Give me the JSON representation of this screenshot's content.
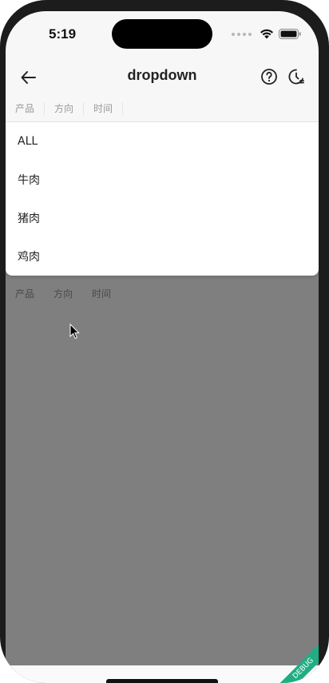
{
  "status_bar": {
    "time": "5:19"
  },
  "app_bar": {
    "title": "dropdown",
    "back_icon": "arrow-left-icon",
    "help_icon": "question-circle-icon",
    "history_icon": "history-icon"
  },
  "filters": {
    "tabs": [
      {
        "label": "产品"
      },
      {
        "label": "方向"
      },
      {
        "label": "时间"
      }
    ]
  },
  "dropdown": {
    "options": [
      {
        "label": "ALL"
      },
      {
        "label": "牛肉"
      },
      {
        "label": "猪肉"
      },
      {
        "label": "鸡肉"
      }
    ]
  },
  "debug_banner": {
    "label": "DEBUG"
  },
  "colors": {
    "overlay": "#7f7f7f",
    "panel": "#ffffff",
    "ribbon": "#1fae83"
  }
}
